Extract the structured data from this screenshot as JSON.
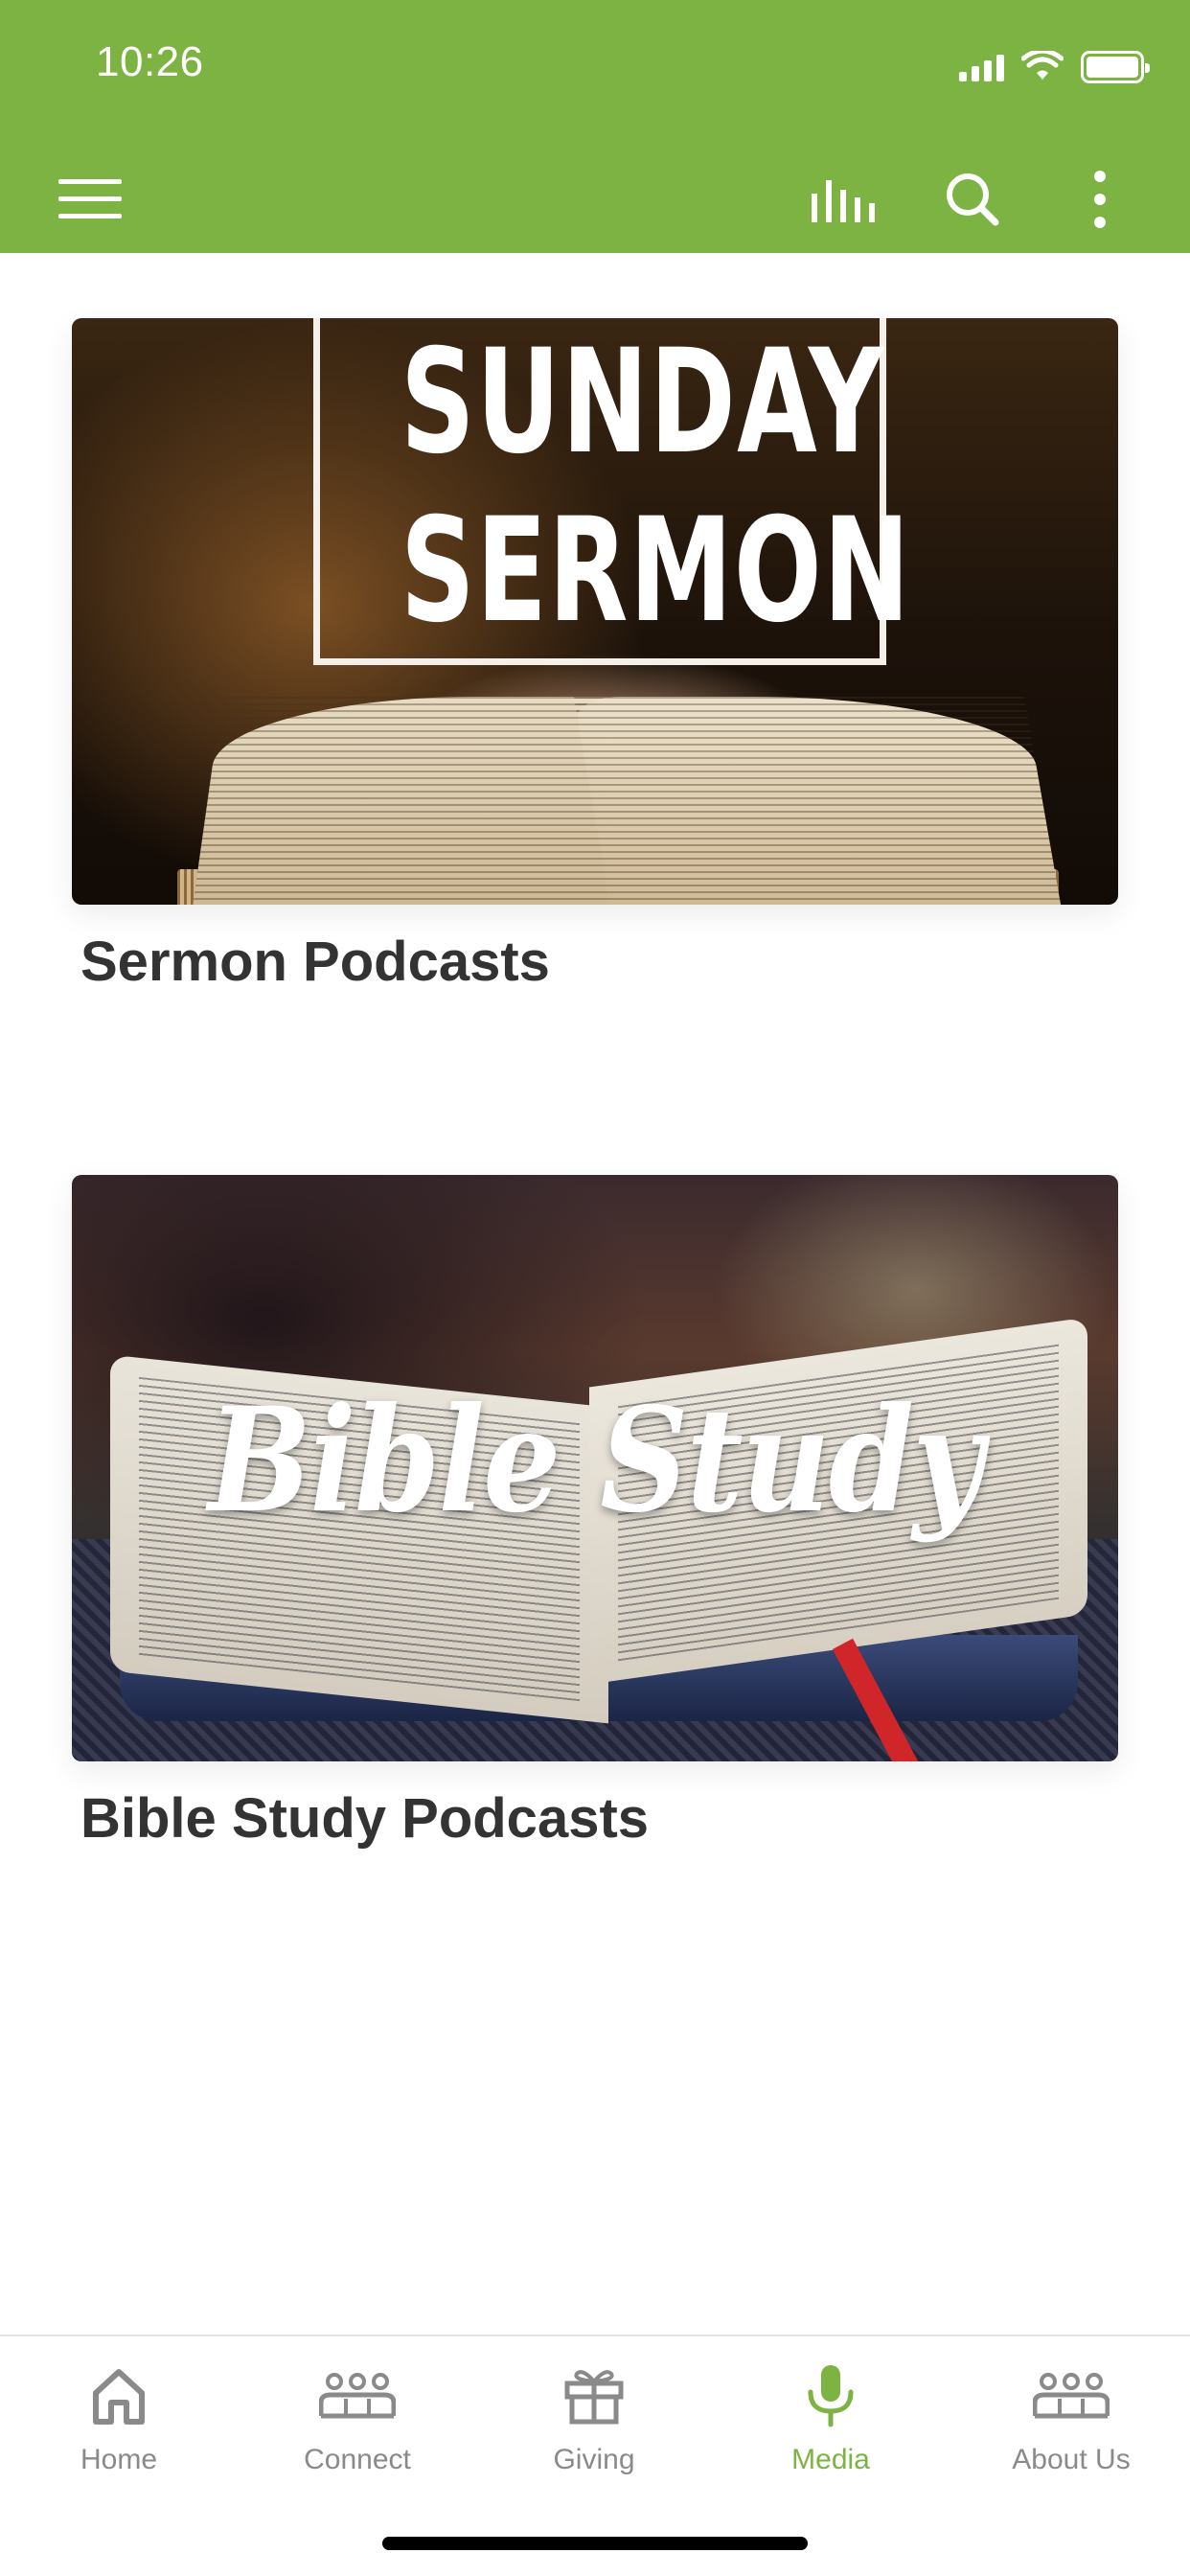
{
  "status_bar": {
    "time": "10:26"
  },
  "app_bar": {
    "background": "#7cb342",
    "icons": [
      "menu-icon",
      "equalizer-icon",
      "search-icon",
      "more-vertical-icon"
    ]
  },
  "cards": [
    {
      "title": "Sermon Podcasts",
      "image_text_line1": "SUNDAY",
      "image_text_line2": "SERMON"
    },
    {
      "title": "Bible Study Podcasts",
      "image_text": "Bible Study"
    }
  ],
  "bottom_nav": {
    "active_color": "#7cb342",
    "inactive_color": "#8a8a8a",
    "items": [
      {
        "label": "Home",
        "icon": "home-icon"
      },
      {
        "label": "Connect",
        "icon": "group-icon"
      },
      {
        "label": "Giving",
        "icon": "gift-icon"
      },
      {
        "label": "Media",
        "icon": "microphone-icon",
        "active": true
      },
      {
        "label": "About Us",
        "icon": "group-icon"
      }
    ]
  }
}
